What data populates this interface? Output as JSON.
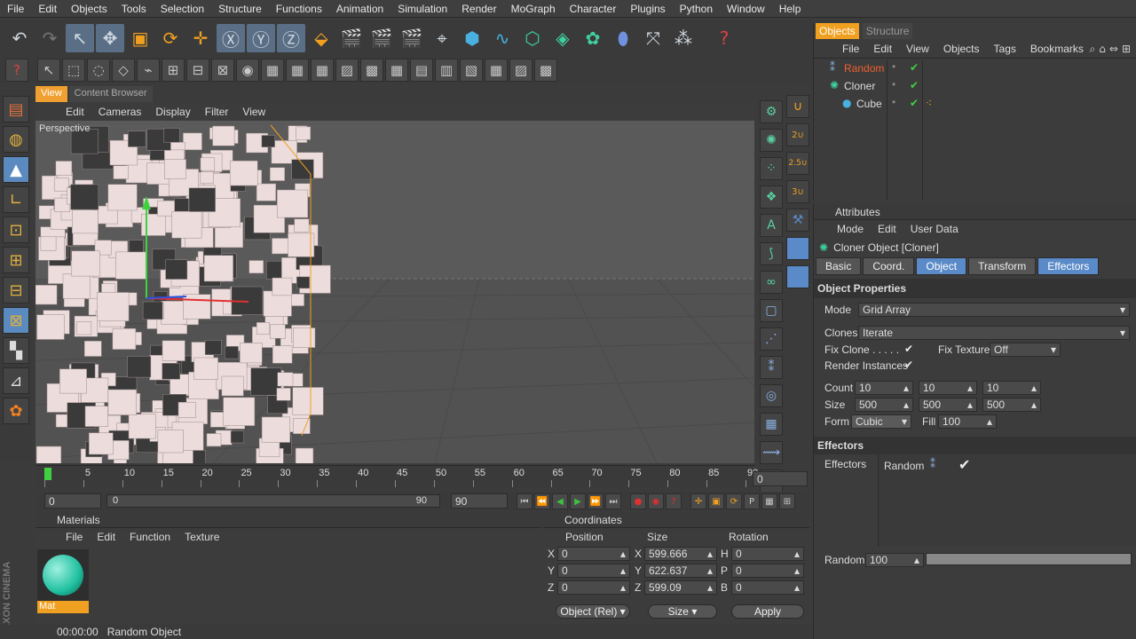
{
  "menu": [
    "File",
    "Edit",
    "Objects",
    "Tools",
    "Selection",
    "Structure",
    "Functions",
    "Animation",
    "Simulation",
    "Render",
    "MoGraph",
    "Character",
    "Plugins",
    "Python",
    "Window",
    "Help"
  ],
  "view_tabs": {
    "view": "View",
    "browser": "Content Browser"
  },
  "view_menu": [
    "Edit",
    "Cameras",
    "Display",
    "Filter",
    "View"
  ],
  "viewport": {
    "label": "Perspective"
  },
  "timeline": {
    "ticks": [
      "0",
      "5",
      "10",
      "15",
      "20",
      "25",
      "30",
      "35",
      "40",
      "45",
      "50",
      "55",
      "60",
      "65",
      "70",
      "75",
      "80",
      "85",
      "90"
    ],
    "frame_field": "0"
  },
  "controls": {
    "start": "0",
    "slider_start": "0",
    "slider_end": "90",
    "end": "90"
  },
  "materials": {
    "title": "Materials",
    "menu": [
      "File",
      "Edit",
      "Function",
      "Texture"
    ],
    "item_label": "Mat"
  },
  "coordinates": {
    "title": "Coordinates",
    "col_position": "Position",
    "col_size": "Size",
    "col_rotation": "Rotation",
    "rows": [
      {
        "axis": "X",
        "pos": "0",
        "size": "599.666",
        "rot_label": "H",
        "rot": "0"
      },
      {
        "axis": "Y",
        "pos": "0",
        "size": "622.637",
        "rot_label": "P",
        "rot": "0"
      },
      {
        "axis": "Z",
        "pos": "0",
        "size": "599.09",
        "rot_label": "B",
        "rot": "0"
      }
    ],
    "mode_select": "Object (Rel)",
    "size_select": "Size",
    "apply": "Apply"
  },
  "status": {
    "time": "00:00:00",
    "message": "Random Object"
  },
  "objects": {
    "tab_objects": "Objects",
    "tab_structure": "Structure",
    "menu": [
      "File",
      "Edit",
      "View",
      "Objects",
      "Tags",
      "Bookmarks"
    ],
    "items": [
      {
        "name": "Random"
      },
      {
        "name": "Cloner"
      },
      {
        "name": "Cube"
      }
    ]
  },
  "attributes": {
    "title": "Attributes",
    "menu": [
      "Mode",
      "Edit",
      "User Data"
    ],
    "object_title": "Cloner Object [Cloner]",
    "tabs": [
      "Basic",
      "Coord.",
      "Object",
      "Transform",
      "Effectors"
    ],
    "section_object": "Object Properties",
    "mode_label": "Mode",
    "mode_value": "Grid Array",
    "clones_label": "Clones",
    "clones_value": "Iterate",
    "fix_clone_label": "Fix Clone . . . . .",
    "fix_texture_label": "Fix Texture",
    "fix_texture_value": "Off",
    "render_instances_label": "Render Instances",
    "count_label": "Count",
    "count": [
      "10",
      "10",
      "10"
    ],
    "size_label": "Size",
    "size": [
      "500",
      "500",
      "500"
    ],
    "form_label": "Form",
    "form_value": "Cubic",
    "fill_label": "Fill",
    "fill_value": "100",
    "section_effectors": "Effectors",
    "effectors_label": "Effectors",
    "effector_item": "Random",
    "random_label": "Random",
    "random_value": "100"
  },
  "branding": "MAXON CINEMA 4D"
}
